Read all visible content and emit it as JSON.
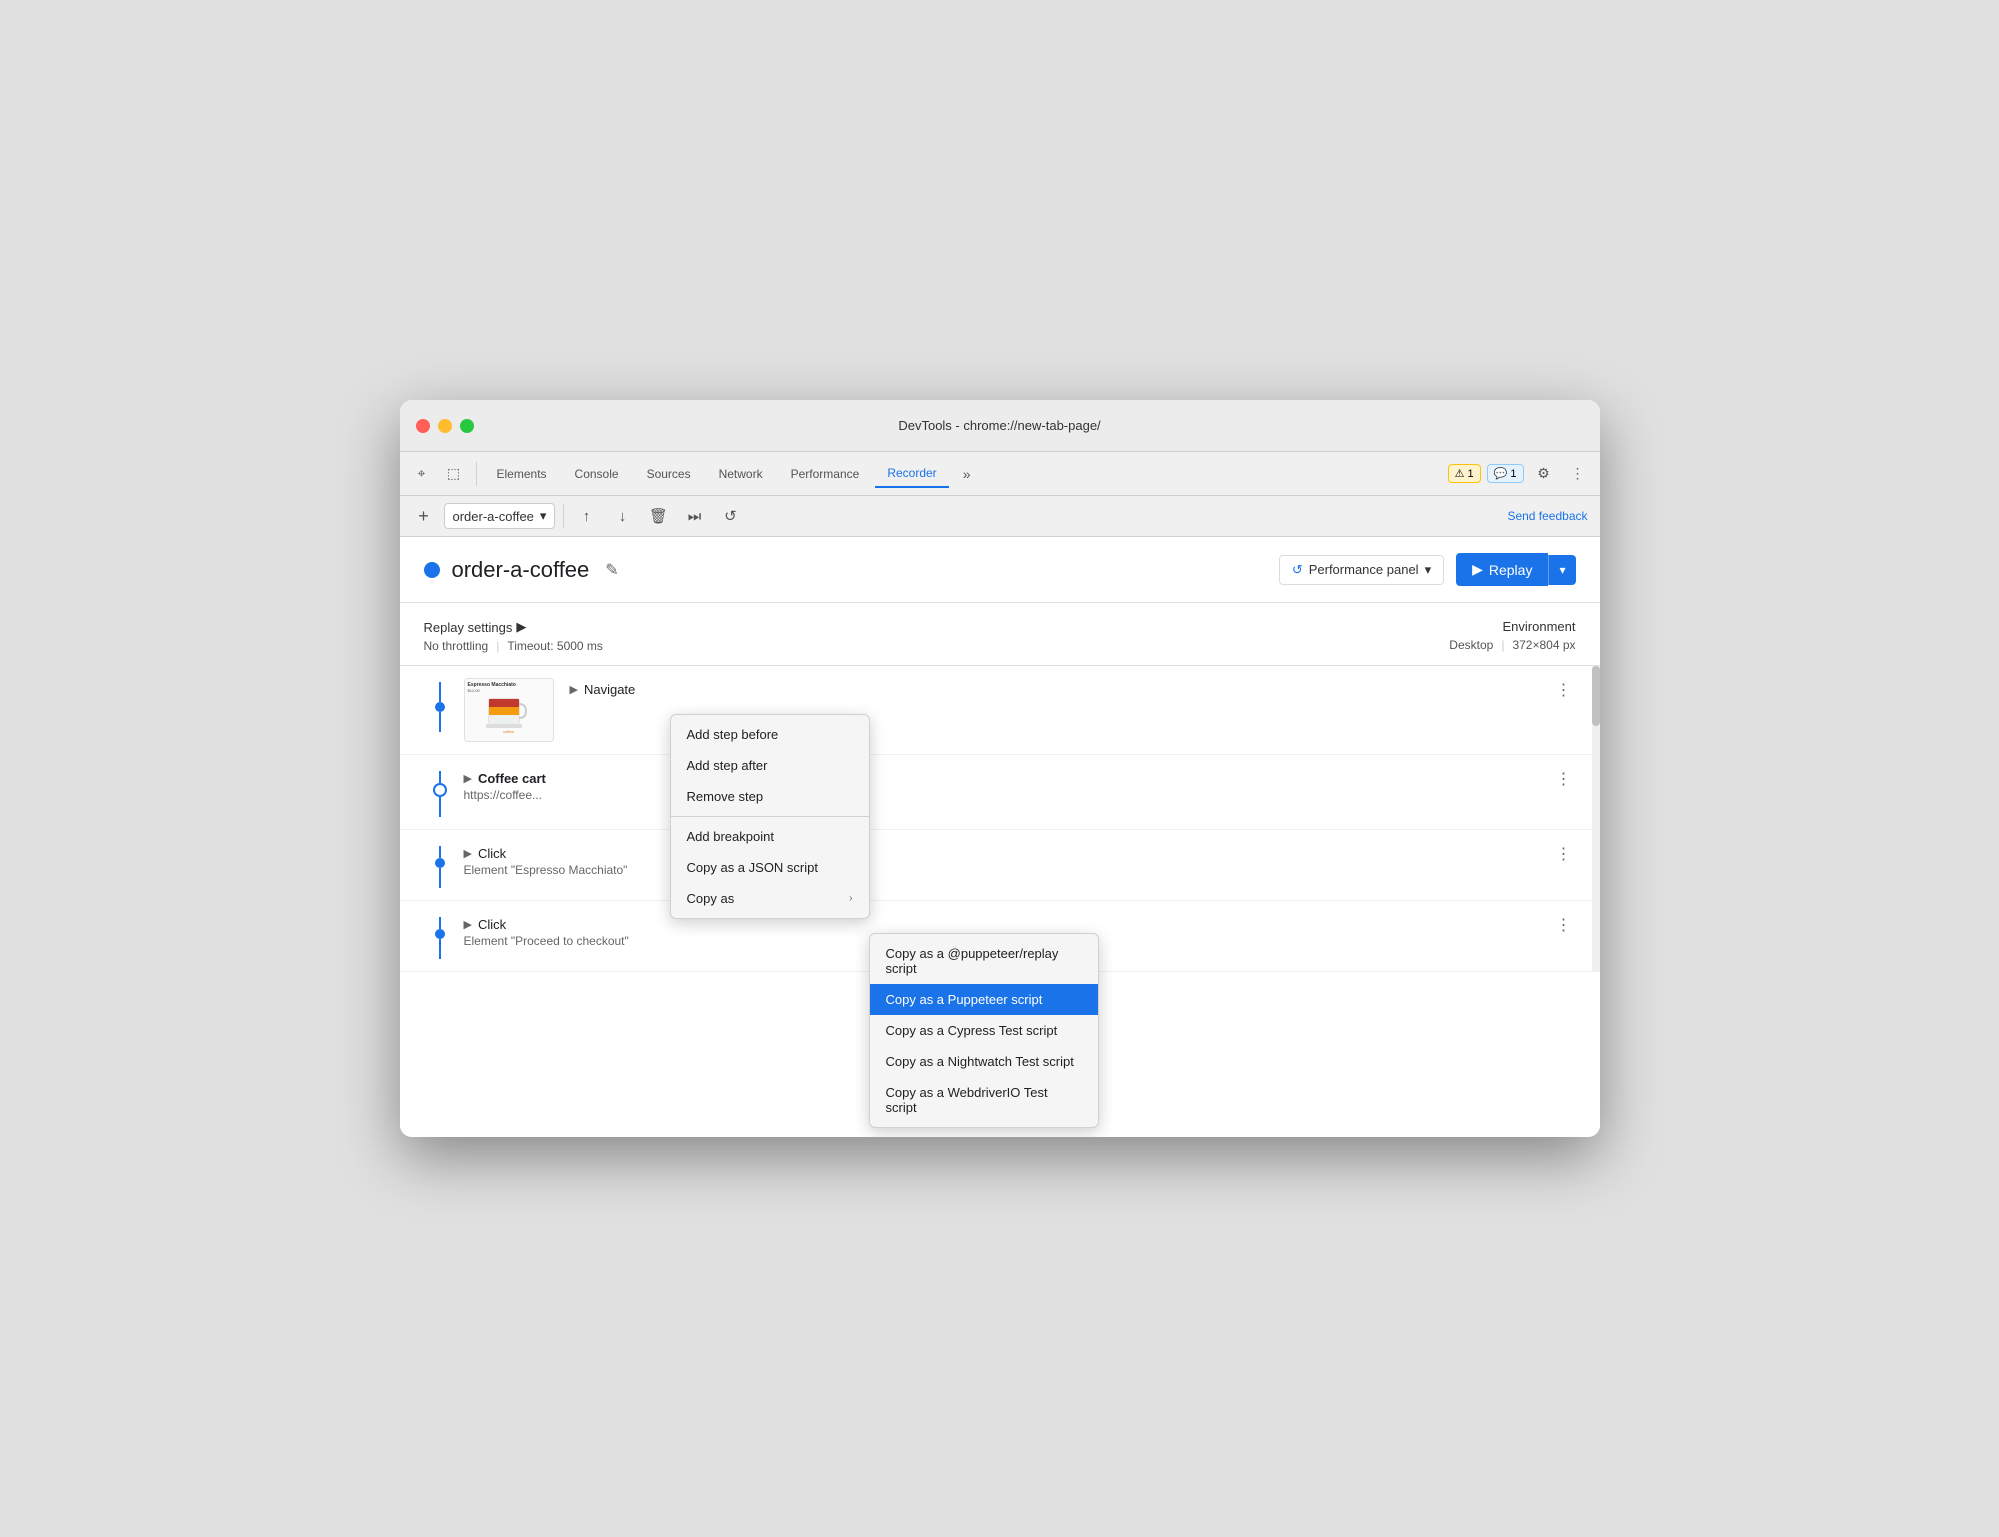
{
  "window": {
    "title": "DevTools - chrome://new-tab-page/"
  },
  "tabs": [
    {
      "label": "Elements",
      "active": false
    },
    {
      "label": "Console",
      "active": false
    },
    {
      "label": "Sources",
      "active": false
    },
    {
      "label": "Network",
      "active": false
    },
    {
      "label": "Performance",
      "active": false
    },
    {
      "label": "Recorder",
      "active": true
    }
  ],
  "toolbar": {
    "recording_name": "order-a-coffee",
    "send_feedback": "Send feedback"
  },
  "header": {
    "recording_title": "order-a-coffee",
    "performance_panel_label": "Performance panel",
    "replay_label": "Replay"
  },
  "settings": {
    "title": "Replay settings",
    "no_throttling": "No throttling",
    "timeout": "Timeout: 5000 ms",
    "environment_title": "Environment",
    "desktop": "Desktop",
    "resolution": "372×804 px"
  },
  "steps": [
    {
      "id": "navigate",
      "label": "Navigate",
      "has_thumbnail": true,
      "is_hollow": false,
      "detail": ""
    },
    {
      "id": "coffee-cart",
      "label": "Coffee cart",
      "has_thumbnail": false,
      "is_hollow": true,
      "detail": "https://coffee..."
    },
    {
      "id": "click-1",
      "label": "Click",
      "has_thumbnail": false,
      "is_hollow": false,
      "detail": "Element \"Espresso Macchiato\""
    },
    {
      "id": "click-2",
      "label": "Click",
      "has_thumbnail": false,
      "is_hollow": false,
      "detail": "Element \"Proceed to checkout\""
    }
  ],
  "context_menu": {
    "items": [
      {
        "label": "Add step before",
        "has_divider_after": false
      },
      {
        "label": "Add step after",
        "has_divider_after": false
      },
      {
        "label": "Remove step",
        "has_divider_after": true
      },
      {
        "label": "Add breakpoint",
        "has_divider_after": false
      },
      {
        "label": "Copy as a JSON script",
        "has_divider_after": false
      },
      {
        "label": "Copy as",
        "has_submenu": true,
        "has_divider_after": false
      }
    ]
  },
  "submenu": {
    "items": [
      {
        "label": "Copy as a @puppeteer/replay script",
        "highlighted": false
      },
      {
        "label": "Copy as a Puppeteer script",
        "highlighted": true
      },
      {
        "label": "Copy as a Cypress Test script",
        "highlighted": false
      },
      {
        "label": "Copy as a Nightwatch Test script",
        "highlighted": false
      },
      {
        "label": "Copy as a WebdriverIO Test script",
        "highlighted": false
      }
    ]
  },
  "icons": {
    "cursor": "⌖",
    "dock": "⬚",
    "chevron_down": "▾",
    "upload": "↑",
    "download": "↓",
    "trash": "🗑",
    "step_forward": "⏭",
    "circle_arrow": "↺",
    "play": "▶",
    "pencil": "✎",
    "more_vert": "⋮",
    "expand": "▶",
    "gear": "⚙",
    "more_horiz": "⋯",
    "warning": "⚠",
    "chat": "💬",
    "chevron_right": "›"
  }
}
